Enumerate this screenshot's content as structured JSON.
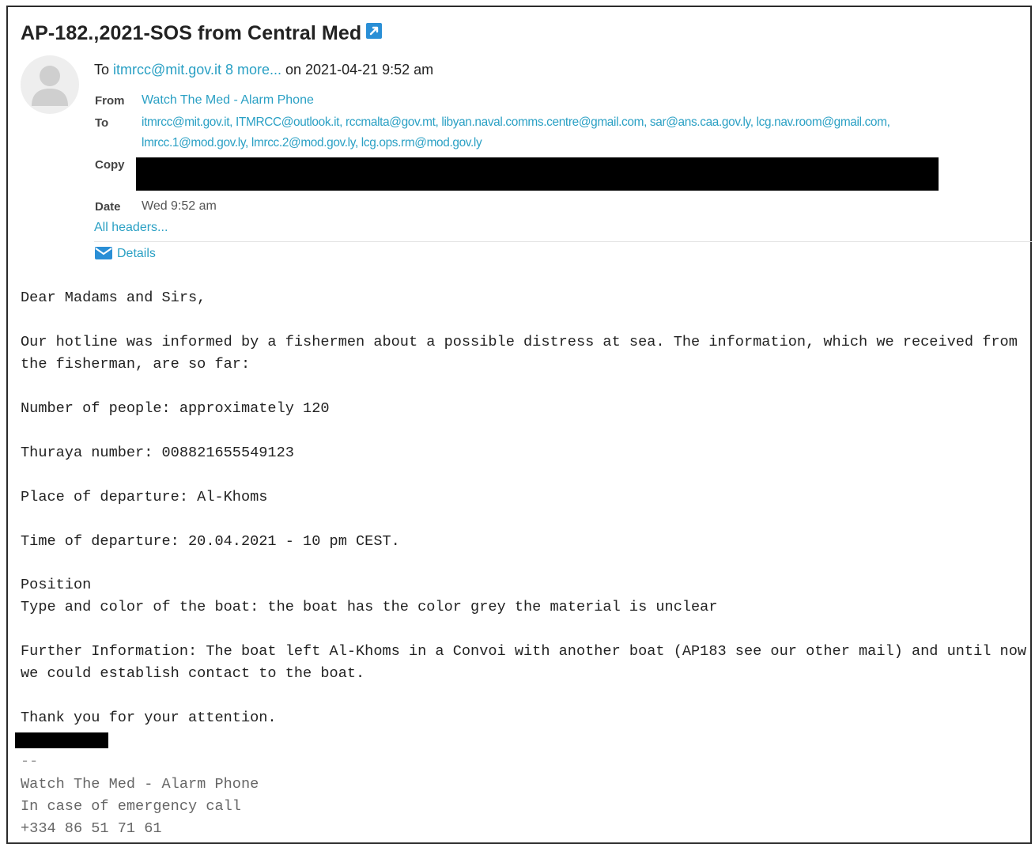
{
  "email": {
    "subject": "AP-182.,2021-SOS from Central Med",
    "summary": {
      "prefix": "To",
      "recipients_link": "itmrcc@mit.gov.it 8 more...",
      "date_text": "on 2021-04-21 9:52 am"
    },
    "headers": {
      "from_label": "From",
      "from_value": "Watch The Med - Alarm Phone",
      "to_label": "To",
      "to_line1": "itmrcc@mit.gov.it, ITMRCC@outlook.it, rccmalta@gov.mt, libyan.naval.comms.centre@gmail.com, sar@ans.caa.gov.ly, lcg.nav.room@gmail.com,",
      "to_line2": "lmrcc.1@mod.gov.ly, lmrcc.2@mod.gov.ly, lcg.ops.rm@mod.gov.ly",
      "copy_label": "Copy",
      "date_label": "Date",
      "date_value": "Wed 9:52 am",
      "all_headers_link": "All headers...",
      "details_link": "Details"
    },
    "body": {
      "greeting": "Dear Madams and Sirs,",
      "intro_line1": "Our hotline was informed by a fishermen about a possible distress at sea. The information, which we received from",
      "intro_line2": "the fisherman, are so far:",
      "people": "Number of people: approximately 120",
      "thuraya": "Thuraya number: 008821655549123",
      "place": "Place of departure: Al-Khoms",
      "time": "Time of departure: 20.04.2021 - 10 pm CEST.",
      "position": "Position",
      "boat_type": "Type and color of the boat: the boat has the color grey the material is unclear",
      "further_line1": "Further Information: The boat left Al-Khoms in a Convoi with another boat (AP183 see our other mail) and until now",
      "further_line2": "we could establish contact to the boat.",
      "thanks": "Thank you for your attention."
    },
    "signature": {
      "separator": "--",
      "org": "Watch The Med - Alarm Phone",
      "emergency": "In case of emergency call",
      "phone": "+334 86 51 71 61"
    }
  },
  "icons": {
    "external_link": "external-link-icon",
    "avatar": "user-avatar-icon",
    "envelope": "envelope-icon"
  },
  "colors": {
    "link": "#2aa0c4",
    "redaction": "#000000"
  }
}
